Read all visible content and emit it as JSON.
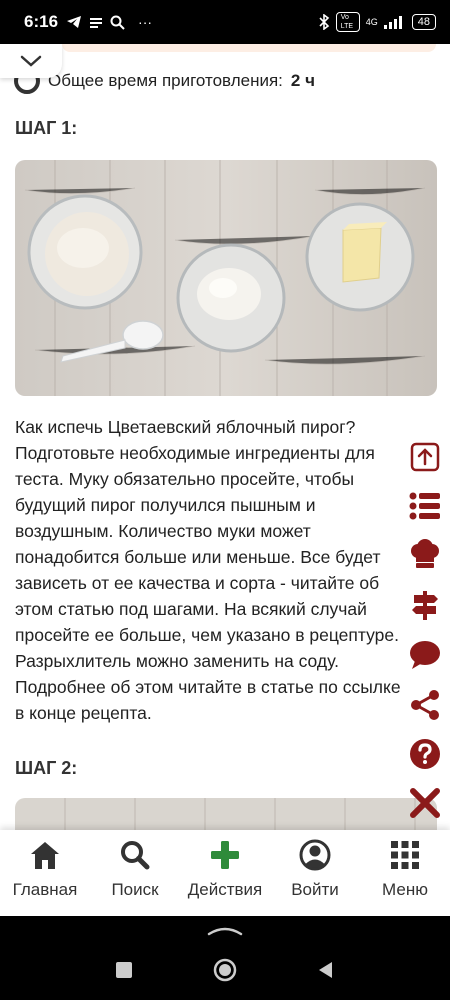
{
  "status_bar": {
    "time": "6:16",
    "more": "···",
    "signal_box": "Vo LTE",
    "network": "4G",
    "battery": "48"
  },
  "recipe": {
    "total_time_label": "Общее время приготовления:",
    "total_time_value": "2 ч",
    "steps": [
      {
        "title": "ШАГ 1:",
        "text": "Как испечь Цветаевский яблочный пирог? Подготовьте необходимые ингредиенты для теста. Муку обязательно просейте, чтобы будущий пирог получился пышным и воздушным. Количество муки может понадобится больше или меньше. Все будет зависеть от ее качества и сорта - читайте об этом статью под шагами. На всякий случай просейте ее больше, чем указано в рецептуре. Разрыхлитель можно заменить на соду. Подробнее об этом читайте в статье по ссылке в конце рецепта."
      },
      {
        "title": "ШАГ 2:"
      }
    ]
  },
  "side_menu": {
    "accent_color": "#8b1a1a",
    "icons": [
      "scroll-up-icon",
      "list-icon",
      "chef-hat-icon",
      "signpost-icon",
      "comment-icon",
      "share-icon",
      "help-icon",
      "close-icon"
    ]
  },
  "bottom_nav": {
    "items": [
      {
        "label": "Главная",
        "icon": "home-icon"
      },
      {
        "label": "Поиск",
        "icon": "search-icon"
      },
      {
        "label": "Действия",
        "icon": "plus-icon",
        "color": "#2e8b3a"
      },
      {
        "label": "Войти",
        "icon": "user-icon"
      },
      {
        "label": "Меню",
        "icon": "grid-icon"
      }
    ]
  }
}
